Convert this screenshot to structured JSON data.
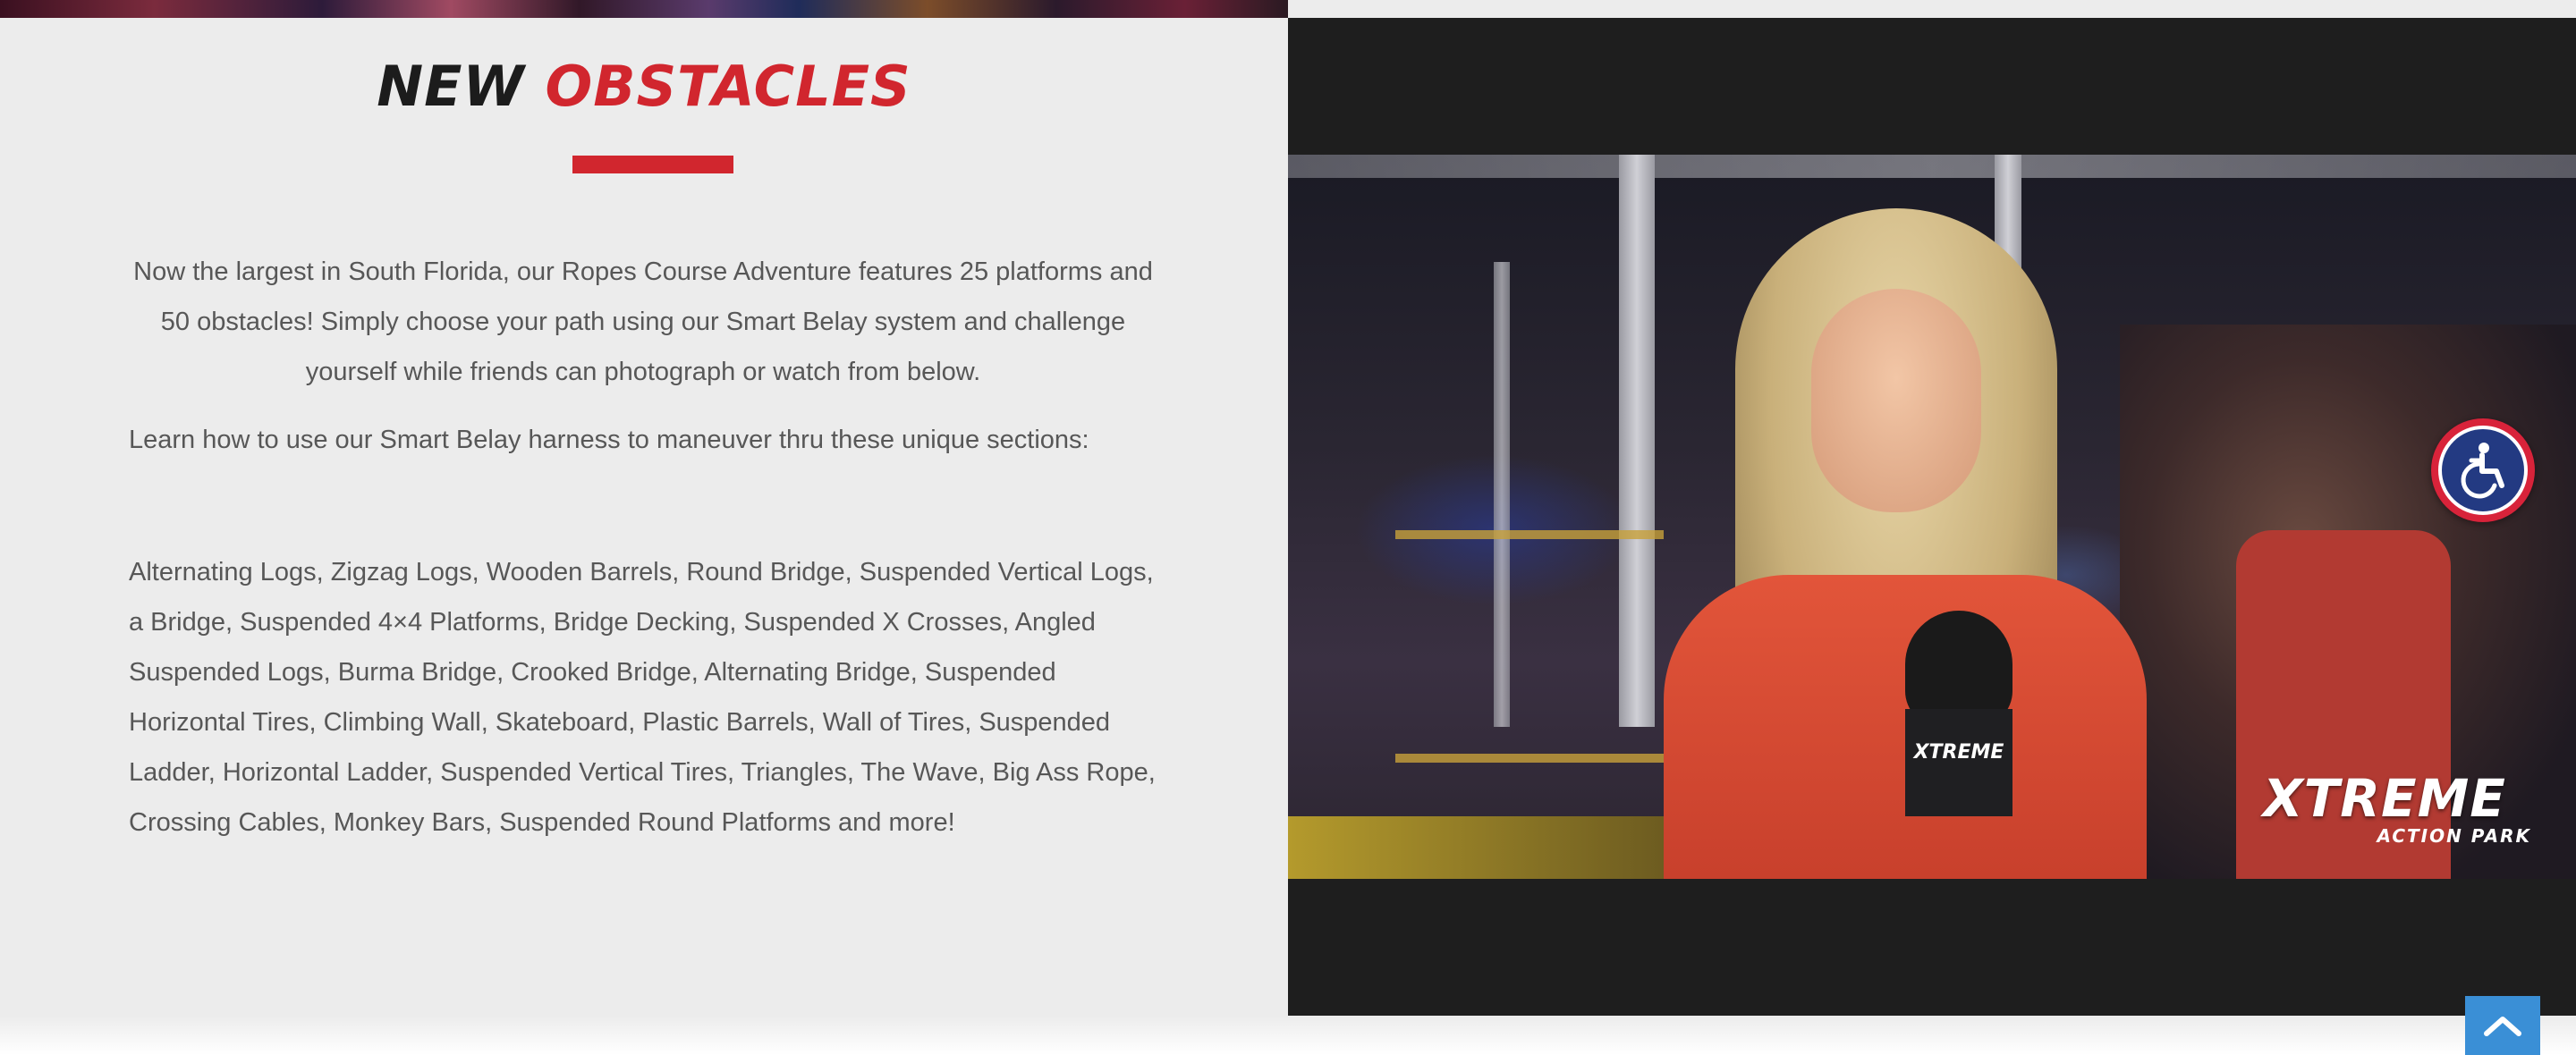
{
  "section": {
    "heading_word_1": "NEW",
    "heading_word_2": "OBSTACLES",
    "accent_color": "#d1262e",
    "paragraph_1": "Now the largest in South Florida, our Ropes Course Adventure features 25 platforms and 50 obstacles!  Simply choose your path using our Smart Belay system and challenge yourself while friends can photograph or watch from below.",
    "paragraph_2": "Learn how to use our Smart Belay harness to maneuver thru these unique sections:",
    "paragraph_3": "Alternating Logs, Zigzag Logs, Wooden Barrels, Round Bridge, Suspended Vertical Logs, a Bridge, Suspended 4×4 Platforms, Bridge Decking, Suspended X Crosses, Angled Suspended Logs, Burma Bridge, Crooked Bridge, Alternating Bridge, Suspended Horizontal Tires, Climbing Wall, Skateboard, Plastic Barrels, Wall of Tires, Suspended Ladder, Horizontal Ladder, Suspended Vertical Tires, Triangles, The Wave, Big Ass Rope, Crossing Cables, Monkey Bars, Suspended Round Platforms and more!"
  },
  "video": {
    "brand_logo": "XTREME",
    "brand_sub": "ACTION PARK",
    "mic_logo": "XTREME"
  },
  "controls": {
    "accessibility_icon": "wheelchair-icon",
    "accessibility_colors": {
      "ring": "#d8233a",
      "inner": "#233a82"
    },
    "scroll_top_icon": "chevron-up-icon",
    "scroll_top_color": "#3a8fd6"
  }
}
